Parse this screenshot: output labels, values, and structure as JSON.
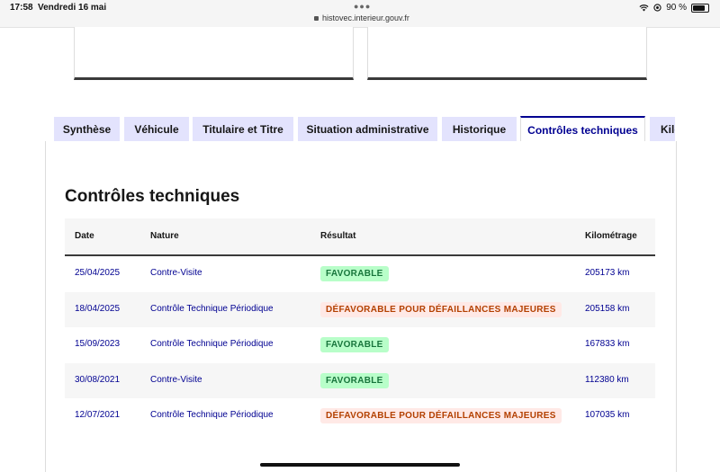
{
  "status_bar": {
    "time": "17:58",
    "date": "Vendredi 16 mai",
    "url": "histovec.interieur.gouv.fr",
    "battery": "90 %",
    "battery_level": 0.9
  },
  "tabs": [
    {
      "label": "Synthèse",
      "active": false
    },
    {
      "label": "Véhicule",
      "active": false
    },
    {
      "label": "Titulaire et Titre",
      "active": false
    },
    {
      "label": "Situation administrative",
      "active": false
    },
    {
      "label": "Historique",
      "active": false
    },
    {
      "label": "Contrôles techniques",
      "active": true
    },
    {
      "label": "Kilométrage",
      "active": false
    }
  ],
  "section": {
    "title": "Contrôles techniques",
    "columns": [
      "Date",
      "Nature",
      "Résultat",
      "Kilométrage"
    ],
    "rows": [
      {
        "date": "25/04/2025",
        "nature": "Contre-Visite",
        "result": "FAVORABLE",
        "status": "ok",
        "km": "205173 km"
      },
      {
        "date": "18/04/2025",
        "nature": "Contrôle Technique Périodique",
        "result": "DÉFAVORABLE POUR DÉFAILLANCES MAJEURES",
        "status": "ko",
        "km": "205158 km"
      },
      {
        "date": "15/09/2023",
        "nature": "Contrôle Technique Périodique",
        "result": "FAVORABLE",
        "status": "ok",
        "km": "167833 km"
      },
      {
        "date": "30/08/2021",
        "nature": "Contre-Visite",
        "result": "FAVORABLE",
        "status": "ok",
        "km": "112380 km"
      },
      {
        "date": "12/07/2021",
        "nature": "Contrôle Technique Périodique",
        "result": "DÉFAVORABLE POUR DÉFAILLANCES MAJEURES",
        "status": "ko",
        "km": "107035 km"
      }
    ]
  },
  "colors": {
    "accent": "#000091",
    "tab_bg": "#e3e3fd",
    "favorable_bg": "#b8fec9",
    "favorable_text": "#18753c",
    "defavorable_bg": "#ffe9e6",
    "defavorable_text": "#b34000"
  }
}
